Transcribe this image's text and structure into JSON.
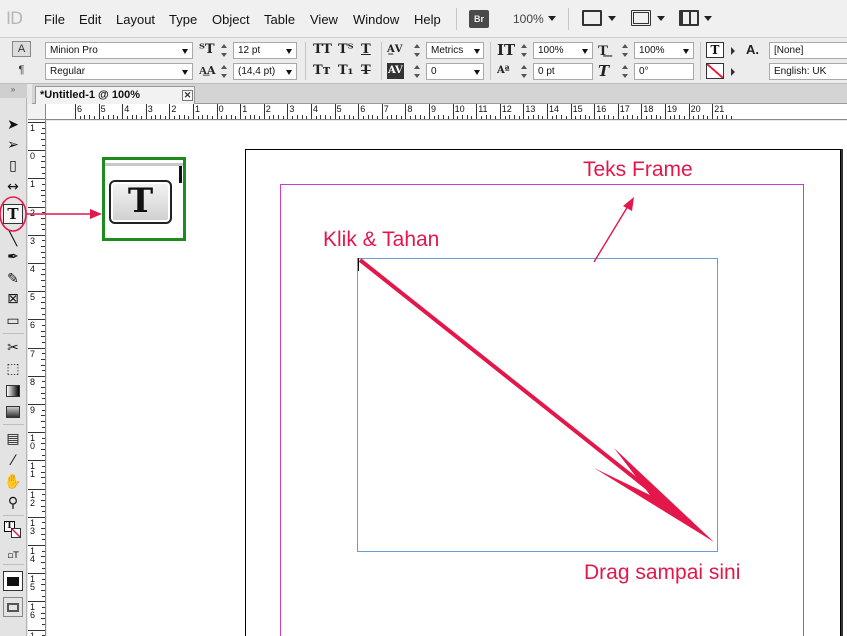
{
  "app": {
    "logo": "ID"
  },
  "menu": [
    "File",
    "Edit",
    "Layout",
    "Type",
    "Object",
    "Table",
    "View",
    "Window",
    "Help"
  ],
  "menubar": {
    "bridge_label": "Br",
    "zoom": "100%"
  },
  "control": {
    "font_family": "Minion Pro",
    "font_style": "Regular",
    "font_size": "12 pt",
    "leading": "(14,4 pt)",
    "kerning": "Metrics",
    "tracking": "0",
    "vertical_scale": "100%",
    "baseline_shift": "0 pt",
    "horizontal_scale": "100%",
    "skew": "0°",
    "char_style": "[None]",
    "language": "English: UK"
  },
  "document": {
    "tab_title": "*Untitled-1 @ 100%",
    "close_glyph": "✕"
  },
  "ruler": {
    "h_labels": [
      "6",
      "5",
      "4",
      "3",
      "2",
      "1",
      "0",
      "1",
      "2",
      "3",
      "4",
      "5",
      "6",
      "7",
      "8",
      "9",
      "10",
      "11",
      "12",
      "13",
      "14",
      "15",
      "16",
      "17",
      "18",
      "19",
      "20",
      "21"
    ],
    "v_labels": [
      "1",
      "0",
      "1",
      "2",
      "3",
      "4",
      "5",
      "6",
      "7",
      "8",
      "9",
      "10",
      "11",
      "12",
      "13",
      "14",
      "15",
      "16",
      "17"
    ]
  },
  "tools": [
    "selection-tool",
    "direct-selection-tool",
    "page-tool",
    "gap-tool",
    "type-tool",
    "line-tool",
    "pen-tool",
    "pencil-tool",
    "rectangle-frame-tool",
    "rectangle-tool",
    "scissors-tool",
    "free-transform-tool",
    "gradient-swatch-tool",
    "gradient-feather-tool",
    "note-tool",
    "eyedropper-tool",
    "hand-tool",
    "zoom-tool",
    "fill-stroke-swatch",
    "formatting-affects",
    "normal-view-mode",
    "preview-mode"
  ],
  "annotations": {
    "teks_frame": "Teks Frame",
    "klik_tahan": "Klik & Tahan",
    "drag": "Drag sampai sini"
  },
  "colors": {
    "annotation": "#e3174a",
    "inset_border": "#1d8b1d",
    "margin": "#c83fd0",
    "frame": "#6a9bd8"
  }
}
